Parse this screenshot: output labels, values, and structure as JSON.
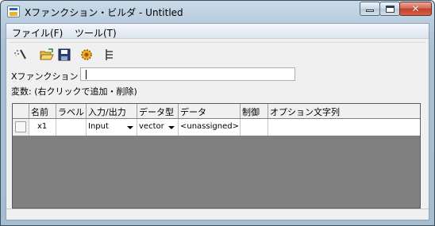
{
  "window": {
    "title": "Xファンクション・ビルダ - Untitled",
    "close_glyph": "✕"
  },
  "menu": {
    "file": "ファイル(F)",
    "tools": "ツール(T)"
  },
  "toolbar": {
    "icons": [
      "new-icon",
      "open-folder-icon",
      "save-icon",
      "compile-gear-icon",
      "tree-view-icon"
    ]
  },
  "form": {
    "xfunction_label": "Xファンクション",
    "xfunction_value": "",
    "variables_label": "変数: (右クリックで追加・削除)"
  },
  "grid": {
    "columns": [
      "名前",
      "ラベル",
      "入力/出力",
      "データ型",
      "データ",
      "制御",
      "オプション文字列"
    ],
    "rows": [
      {
        "name": "x1",
        "label": "",
        "io": "Input",
        "type": "vector",
        "data": "<unassigned>",
        "control": "",
        "option": ""
      }
    ]
  }
}
